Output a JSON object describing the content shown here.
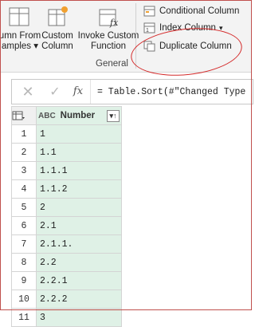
{
  "ribbon": {
    "column_from_examples": {
      "line1": "umn From",
      "line2": "amples"
    },
    "custom_column": {
      "line1": "Custom",
      "line2": "Column"
    },
    "invoke_custom_function": {
      "line1": "Invoke Custom",
      "line2": "Function"
    },
    "conditional_column": "Conditional Column",
    "index_column": "Index Column",
    "duplicate_column": "Duplicate Column",
    "group_label": "General"
  },
  "formula_bar": {
    "cancel_icon": "close-icon",
    "commit_icon": "check-icon",
    "fx": "fx",
    "formula": "= Table.Sort(#\"Changed Type"
  },
  "grid": {
    "column_type": "ABC",
    "column_header": "Number",
    "rows": [
      {
        "n": "1",
        "v": "1"
      },
      {
        "n": "2",
        "v": "1.1"
      },
      {
        "n": "3",
        "v": "1.1.1"
      },
      {
        "n": "4",
        "v": "1.1.2"
      },
      {
        "n": "5",
        "v": "2"
      },
      {
        "n": "6",
        "v": "2.1"
      },
      {
        "n": "7",
        "v": "2.1.1."
      },
      {
        "n": "8",
        "v": "2.2"
      },
      {
        "n": "9",
        "v": "2.2.1"
      },
      {
        "n": "10",
        "v": "2.2.2"
      },
      {
        "n": "11",
        "v": "3"
      }
    ]
  },
  "colors": {
    "annotation_circle": "#d42a2a",
    "column_fill": "#dff1e6"
  }
}
